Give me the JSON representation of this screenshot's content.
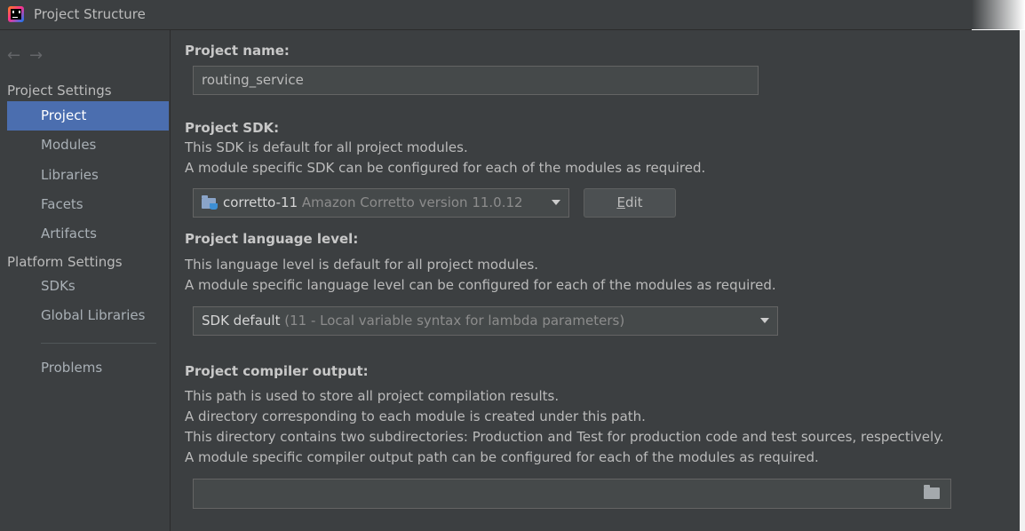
{
  "window": {
    "title": "Project Structure"
  },
  "nav": {
    "back_glyph": "←",
    "forward_glyph": "→"
  },
  "sidebar": {
    "project_settings_header": "Project Settings",
    "project_settings_items": [
      {
        "label": "Project",
        "selected": true
      },
      {
        "label": "Modules"
      },
      {
        "label": "Libraries"
      },
      {
        "label": "Facets"
      },
      {
        "label": "Artifacts"
      }
    ],
    "platform_settings_header": "Platform Settings",
    "platform_settings_items": [
      {
        "label": "SDKs"
      },
      {
        "label": "Global Libraries"
      }
    ],
    "problems_label": "Problems"
  },
  "project": {
    "name_label": "Project name:",
    "name_value": "routing_service",
    "sdk_label": "Project SDK:",
    "sdk_desc": [
      "This SDK is default for all project modules.",
      "A module specific SDK can be configured for each of the modules as required."
    ],
    "sdk_name": "corretto-11",
    "sdk_version": "Amazon Corretto version 11.0.12",
    "edit_button_mnemonic": "E",
    "edit_button_rest": "dit",
    "language_label": "Project language level:",
    "language_desc": [
      "This language level is default for all project modules.",
      "A module specific language level can be configured for each of the modules as required."
    ],
    "language_value": "SDK default",
    "language_detail": "(11 - Local variable syntax for lambda parameters)",
    "compiler_label": "Project compiler output:",
    "compiler_desc": [
      "This path is used to store all project compilation results.",
      "A directory corresponding to each module is created under this path.",
      "This directory contains two subdirectories: Production and Test for production code and test sources, respectively.",
      "A module specific compiler output path can be configured for each of the modules as required."
    ],
    "compiler_output_value": ""
  },
  "colors": {
    "background": "#3c3f41",
    "selection": "#4b6eaf",
    "field": "#45494a",
    "text": "#bbbbbb"
  }
}
